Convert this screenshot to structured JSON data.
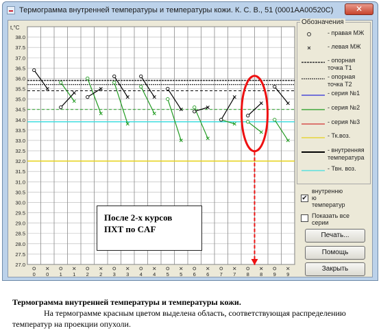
{
  "window": {
    "title": "Термограмма внутренней температуры и температуры кожи.  К. С. В., 51 (0001АА00520С)",
    "close_glyph": "✕"
  },
  "legend": {
    "title": "Обозначения",
    "items": [
      {
        "label": "- правая МЖ",
        "symbol": "circle",
        "color": "#333333"
      },
      {
        "label": "- левая МЖ",
        "symbol": "cross",
        "color": "#333333"
      },
      {
        "label": "- опорная\nточка Т1",
        "symbol": "hatched",
        "color": "#333333"
      },
      {
        "label": "- опорная\nточка Т2",
        "symbol": "hatched2",
        "color": "#333333"
      },
      {
        "label": "- серия №1",
        "symbol": "line",
        "color": "#2a2ad8"
      },
      {
        "label": "- серия №2",
        "symbol": "line",
        "color": "#1f9a1f"
      },
      {
        "label": "- серия №3",
        "symbol": "line",
        "color": "#d33030"
      },
      {
        "label": "- Тк.воз.",
        "symbol": "line",
        "color": "#e6d21a"
      },
      {
        "label": "- внутренняя\nтемпература",
        "symbol": "line-thick",
        "color": "#000000"
      },
      {
        "label": "- Твн. воз.",
        "symbol": "line",
        "color": "#3fdde0"
      }
    ]
  },
  "checkboxes": {
    "internal": {
      "label": "внутренню\nю\nтемператур",
      "checked": true,
      "mark": "✔"
    },
    "show_all": {
      "label": "Показать все\nсерии",
      "checked": false,
      "mark": ""
    }
  },
  "buttons": {
    "print": "Печать...",
    "help": "Помощь",
    "close": "Закрыть"
  },
  "annotation": {
    "line1": "После 2-х курсов",
    "line2": "ПХТ по CAF"
  },
  "caption": {
    "title": "Термограмма  внутренней температуры и  температуры кожи.",
    "body": "На термограмме красным цветом выделена область, соответствующая распределению температур на проекции опухоли."
  },
  "colors": {
    "internal": "#000000",
    "series2": "#1f9a1f",
    "skin_env": "#e6d21a",
    "internal_env": "#3fdde0",
    "ref": "#333333",
    "highlight": "#ee1111"
  },
  "chart_data": {
    "type": "line",
    "ylabel": "t,°C",
    "ylim": [
      27.0,
      38.5
    ],
    "yticks": [
      "38.5",
      "38.0",
      "37.5",
      "37.0",
      "36.5",
      "36.0",
      "35.5",
      "35.0",
      "34.5",
      "34.0",
      "33.5",
      "33.0",
      "32.5",
      "32.0",
      "31.5",
      "31.0",
      "30.5",
      "30.0",
      "29.5",
      "29.0",
      "28.5",
      "28.0",
      "27.5",
      "27.0"
    ],
    "x_labels": [
      "0",
      "0",
      "1",
      "1",
      "2",
      "2",
      "3",
      "3",
      "4",
      "4",
      "5",
      "5",
      "6",
      "6",
      "7",
      "7",
      "8",
      "8",
      "9",
      "9"
    ],
    "x_markers": [
      "circle",
      "cross",
      "circle",
      "cross",
      "circle",
      "cross",
      "circle",
      "cross",
      "circle",
      "cross",
      "circle",
      "cross",
      "circle",
      "cross",
      "circle",
      "cross",
      "circle",
      "cross",
      "circle",
      "cross"
    ],
    "internal_segments": [
      [
        [
          0,
          36.4
        ],
        [
          1,
          35.5
        ]
      ],
      [
        [
          2,
          34.6
        ],
        [
          3,
          35.3
        ]
      ],
      [
        [
          4,
          35.1
        ],
        [
          5,
          35.5
        ]
      ],
      [
        [
          6,
          36.1
        ],
        [
          7,
          35.1
        ]
      ],
      [
        [
          8,
          36.1
        ],
        [
          9,
          35.1
        ]
      ],
      [
        [
          10,
          35.5
        ],
        [
          11,
          34.5
        ]
      ],
      [
        [
          12,
          34.4
        ],
        [
          13,
          34.6
        ]
      ],
      [
        [
          14,
          34.0
        ],
        [
          15,
          35.1
        ]
      ],
      [
        [
          16,
          34.2
        ],
        [
          17,
          34.8
        ]
      ],
      [
        [
          18,
          35.6
        ],
        [
          19,
          34.8
        ]
      ]
    ],
    "series2_segments": [
      [
        [
          2,
          35.8
        ],
        [
          3,
          34.9
        ]
      ],
      [
        [
          4,
          36.0
        ],
        [
          5,
          34.3
        ]
      ],
      [
        [
          6,
          35.8
        ],
        [
          7,
          33.8
        ]
      ],
      [
        [
          8,
          35.6
        ],
        [
          9,
          34.3
        ]
      ],
      [
        [
          10,
          35.0
        ],
        [
          11,
          33.0
        ]
      ],
      [
        [
          12,
          34.6
        ],
        [
          13,
          33.1
        ]
      ],
      [
        [
          14,
          34.0
        ],
        [
          15,
          33.8
        ]
      ],
      [
        [
          16,
          33.9
        ],
        [
          17,
          33.4
        ]
      ],
      [
        [
          18,
          34.0
        ],
        [
          19,
          33.0
        ]
      ]
    ],
    "reference_T1": 35.9,
    "reference_T2": 35.7,
    "internal_env": 33.9,
    "skin_env": 32.0,
    "series2_dashed": 34.5,
    "internal_dashed": 35.4,
    "highlight_x": 16.5
  }
}
